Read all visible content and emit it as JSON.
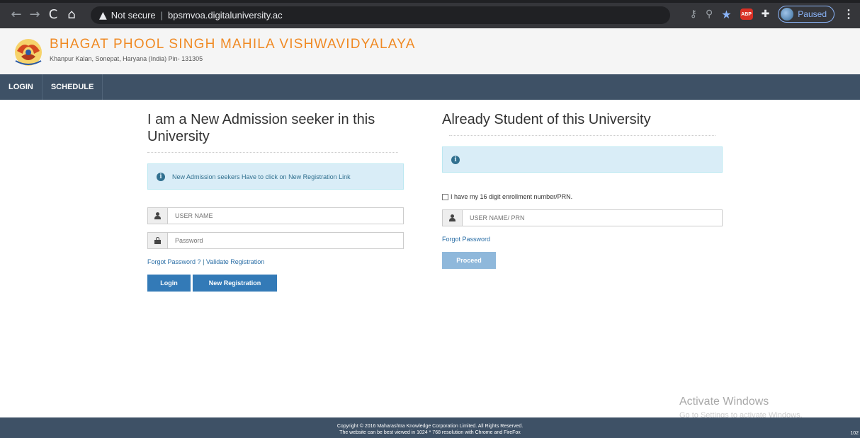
{
  "browser": {
    "security_label": "Not secure",
    "url": "bpsmvoa.digitaluniversity.ac",
    "profile_status": "Paused",
    "adblock_label": "ABP"
  },
  "header": {
    "university_name": "BHAGAT PHOOL SINGH MAHILA VISHWAVIDYALAYA",
    "address": "Khanpur Kalan, Sonepat, Haryana (India) Pin- 131305"
  },
  "nav": {
    "items": [
      {
        "label": "LOGIN"
      },
      {
        "label": "SCHEDULE"
      }
    ]
  },
  "new_admission": {
    "title": "I am a New Admission seeker in this University",
    "info": "New Admission seekers Have to click on New Registration Link",
    "username_placeholder": "USER NAME",
    "password_placeholder": "Password",
    "forgot_password_link": "Forgot Password ?",
    "link_separator": "|",
    "validate_link": "Validate Registration",
    "login_button": "Login",
    "new_registration_button": "New Registration"
  },
  "existing_student": {
    "title": "Already Student of this University",
    "info": "",
    "checkbox_label": "I have my 16 digit enrollment number/PRN.",
    "username_placeholder": "USER NAME/ PRN",
    "forgot_password_link": "Forgot Password",
    "proceed_button": "Proceed"
  },
  "watermark": {
    "line1": "Activate Windows",
    "line2": "Go to Settings to activate Windows."
  },
  "footer": {
    "line1": "Copyright © 2016 Maharashtra Knowledge Corporation Limited. All Rights Reserved.",
    "line2": "The website can be best viewed in 1024 * 768 resolution with Chrome and FireFox",
    "corner_text": "102"
  },
  "colors": {
    "accent_orange": "#f08a24",
    "navbar": "#3e5166",
    "button_primary": "#337ab7",
    "info_background": "#d9edf7"
  }
}
